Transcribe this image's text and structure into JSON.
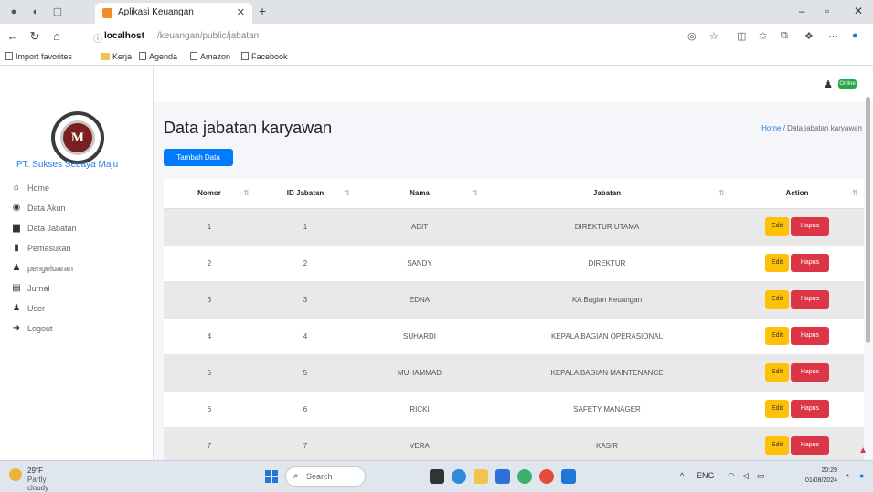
{
  "browser": {
    "tab_title": "Aplikasi Keuangan",
    "url_host": "localhost",
    "url_path": "/keuangan/public/jabatan",
    "bookmarks": [
      "Import favorites",
      "Kerja",
      "Agenda",
      "Amazon",
      "Facebook"
    ]
  },
  "sidebar": {
    "logo_text": "M",
    "company": "PT. Sukses Sedaya Maju",
    "items": [
      {
        "label": "Home",
        "icon": "home-icon"
      },
      {
        "label": "Data Akun",
        "icon": "globe-icon"
      },
      {
        "label": "Data Jabatan",
        "icon": "car-icon"
      },
      {
        "label": "Pemasukan",
        "icon": "document-icon"
      },
      {
        "label": "pengeluaran",
        "icon": "user-icon"
      },
      {
        "label": "Jurnal",
        "icon": "id-card-icon"
      },
      {
        "label": "User",
        "icon": "user-icon"
      },
      {
        "label": "Logout",
        "icon": "logout-icon"
      }
    ]
  },
  "topnav": {
    "status": "Online"
  },
  "page": {
    "title": "Data jabatan karyawan",
    "breadcrumb_home": "Home",
    "breadcrumb_current": "Data jabatan karyawan",
    "add_button": "Tambah Data"
  },
  "table": {
    "headers": [
      "Nomor",
      "ID Jabatan",
      "Nama",
      "Jabatan",
      "Action"
    ],
    "edit_label": "Edit",
    "delete_label": "Hapus",
    "rows": [
      [
        "1",
        "1",
        "ADIT",
        "DIREKTUR UTAMA"
      ],
      [
        "2",
        "2",
        "SANDY",
        "DIREKTUR"
      ],
      [
        "3",
        "3",
        "EDNA",
        "KA Bagian Keuangan"
      ],
      [
        "4",
        "4",
        "SUHARDI",
        "KEPALA BAGIAN OPERASIONAL"
      ],
      [
        "5",
        "5",
        "MUHAMMAD",
        "KEPALA BAGIAN MAINTENANCE"
      ],
      [
        "6",
        "6",
        "RICKI",
        "SAFETY MANAGER"
      ],
      [
        "7",
        "7",
        "VERA",
        "KASIR"
      ]
    ]
  },
  "taskbar": {
    "weather_temp": "29°F",
    "weather_desc": "Partly cloudy",
    "search_placeholder": "Search",
    "time": "20:29",
    "date": "01/08/2024"
  }
}
